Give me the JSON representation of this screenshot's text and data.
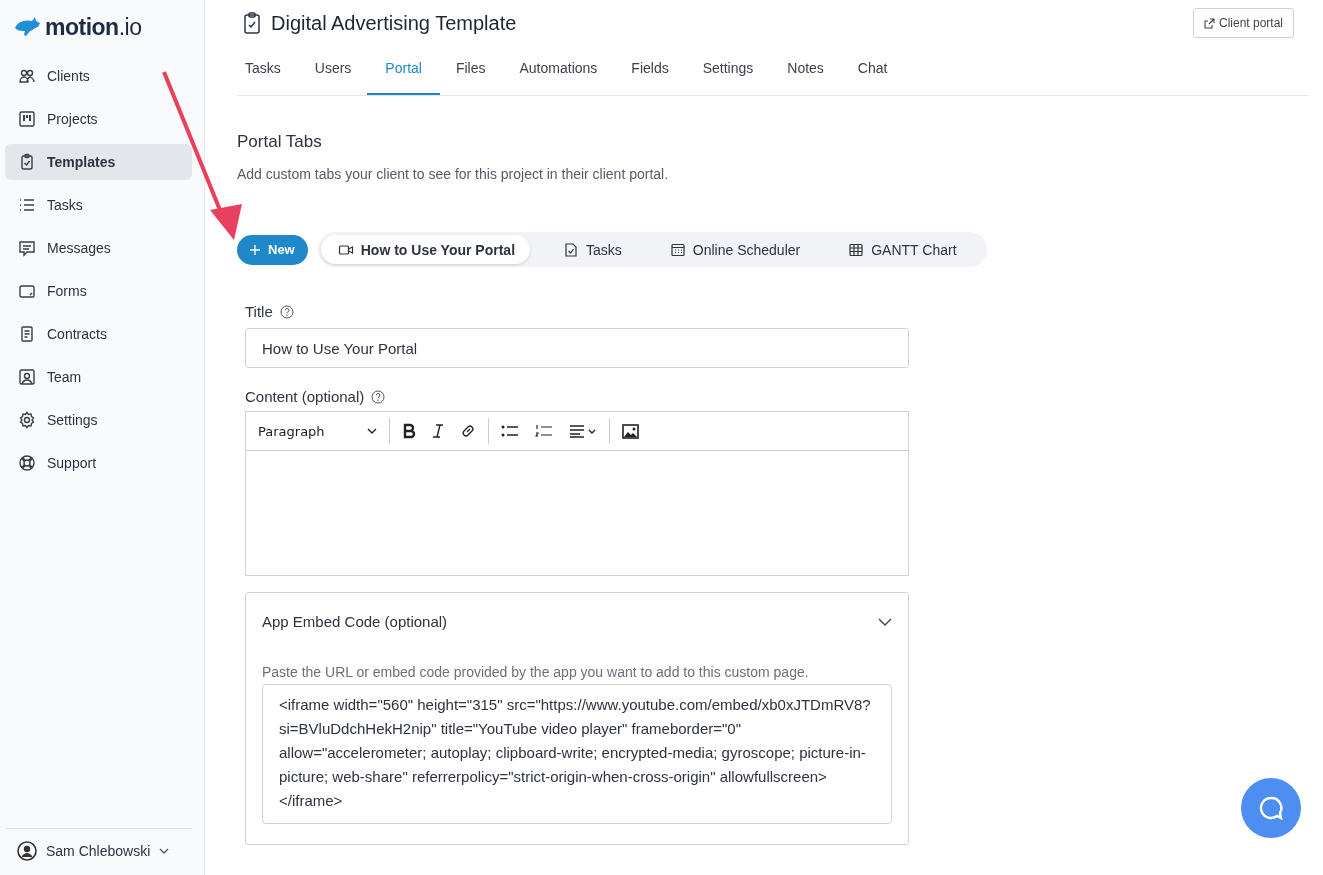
{
  "brand": {
    "name": "motion",
    "suffix": ".io"
  },
  "sidebar": {
    "items": [
      {
        "label": "Clients",
        "selected": false
      },
      {
        "label": "Projects",
        "selected": false
      },
      {
        "label": "Templates",
        "selected": true
      },
      {
        "label": "Tasks",
        "selected": false
      },
      {
        "label": "Messages",
        "selected": false
      },
      {
        "label": "Forms",
        "selected": false
      },
      {
        "label": "Contracts",
        "selected": false
      },
      {
        "label": "Team",
        "selected": false
      },
      {
        "label": "Settings",
        "selected": false
      },
      {
        "label": "Support",
        "selected": false
      }
    ],
    "user": {
      "name": "Sam Chlebowski"
    }
  },
  "header": {
    "title": "Digital Advertising Template",
    "client_portal_button": "Client portal"
  },
  "tabs": [
    {
      "label": "Tasks",
      "selected": false
    },
    {
      "label": "Users",
      "selected": false
    },
    {
      "label": "Portal",
      "selected": true
    },
    {
      "label": "Files",
      "selected": false
    },
    {
      "label": "Automations",
      "selected": false
    },
    {
      "label": "Fields",
      "selected": false
    },
    {
      "label": "Settings",
      "selected": false
    },
    {
      "label": "Notes",
      "selected": false
    },
    {
      "label": "Chat",
      "selected": false
    }
  ],
  "portal": {
    "heading": "Portal Tabs",
    "description": "Add custom tabs your client to see for this project in their client portal.",
    "new_button": "New",
    "portal_tabs": [
      {
        "label": "How to Use Your Portal",
        "kind": "video",
        "selected": true
      },
      {
        "label": "Tasks",
        "kind": "tasks",
        "selected": false
      },
      {
        "label": "Online Scheduler",
        "kind": "calendar",
        "selected": false
      },
      {
        "label": "GANTT Chart",
        "kind": "table",
        "selected": false
      }
    ]
  },
  "form": {
    "title_label": "Title",
    "title_value": "How to Use Your Portal",
    "content_label": "Content (optional)",
    "block_format": "Paragraph",
    "embed": {
      "heading": "App Embed Code (optional)",
      "expanded": true,
      "hint": "Paste the URL or embed code provided by the app you want to add to this custom page.",
      "code": "<iframe width=\"560\" height=\"315\" src=\"https://www.youtube.com/embed/xb0xJTDmRV8?si=BVluDdchHekH2nip\" title=\"YouTube video player\" frameborder=\"0\" allow=\"accelerometer; autoplay; clipboard-write; encrypted-media; gyroscope; picture-in-picture; web-share\" referrerpolicy=\"strict-origin-when-cross-origin\" allowfullscreen></iframe>"
    }
  }
}
